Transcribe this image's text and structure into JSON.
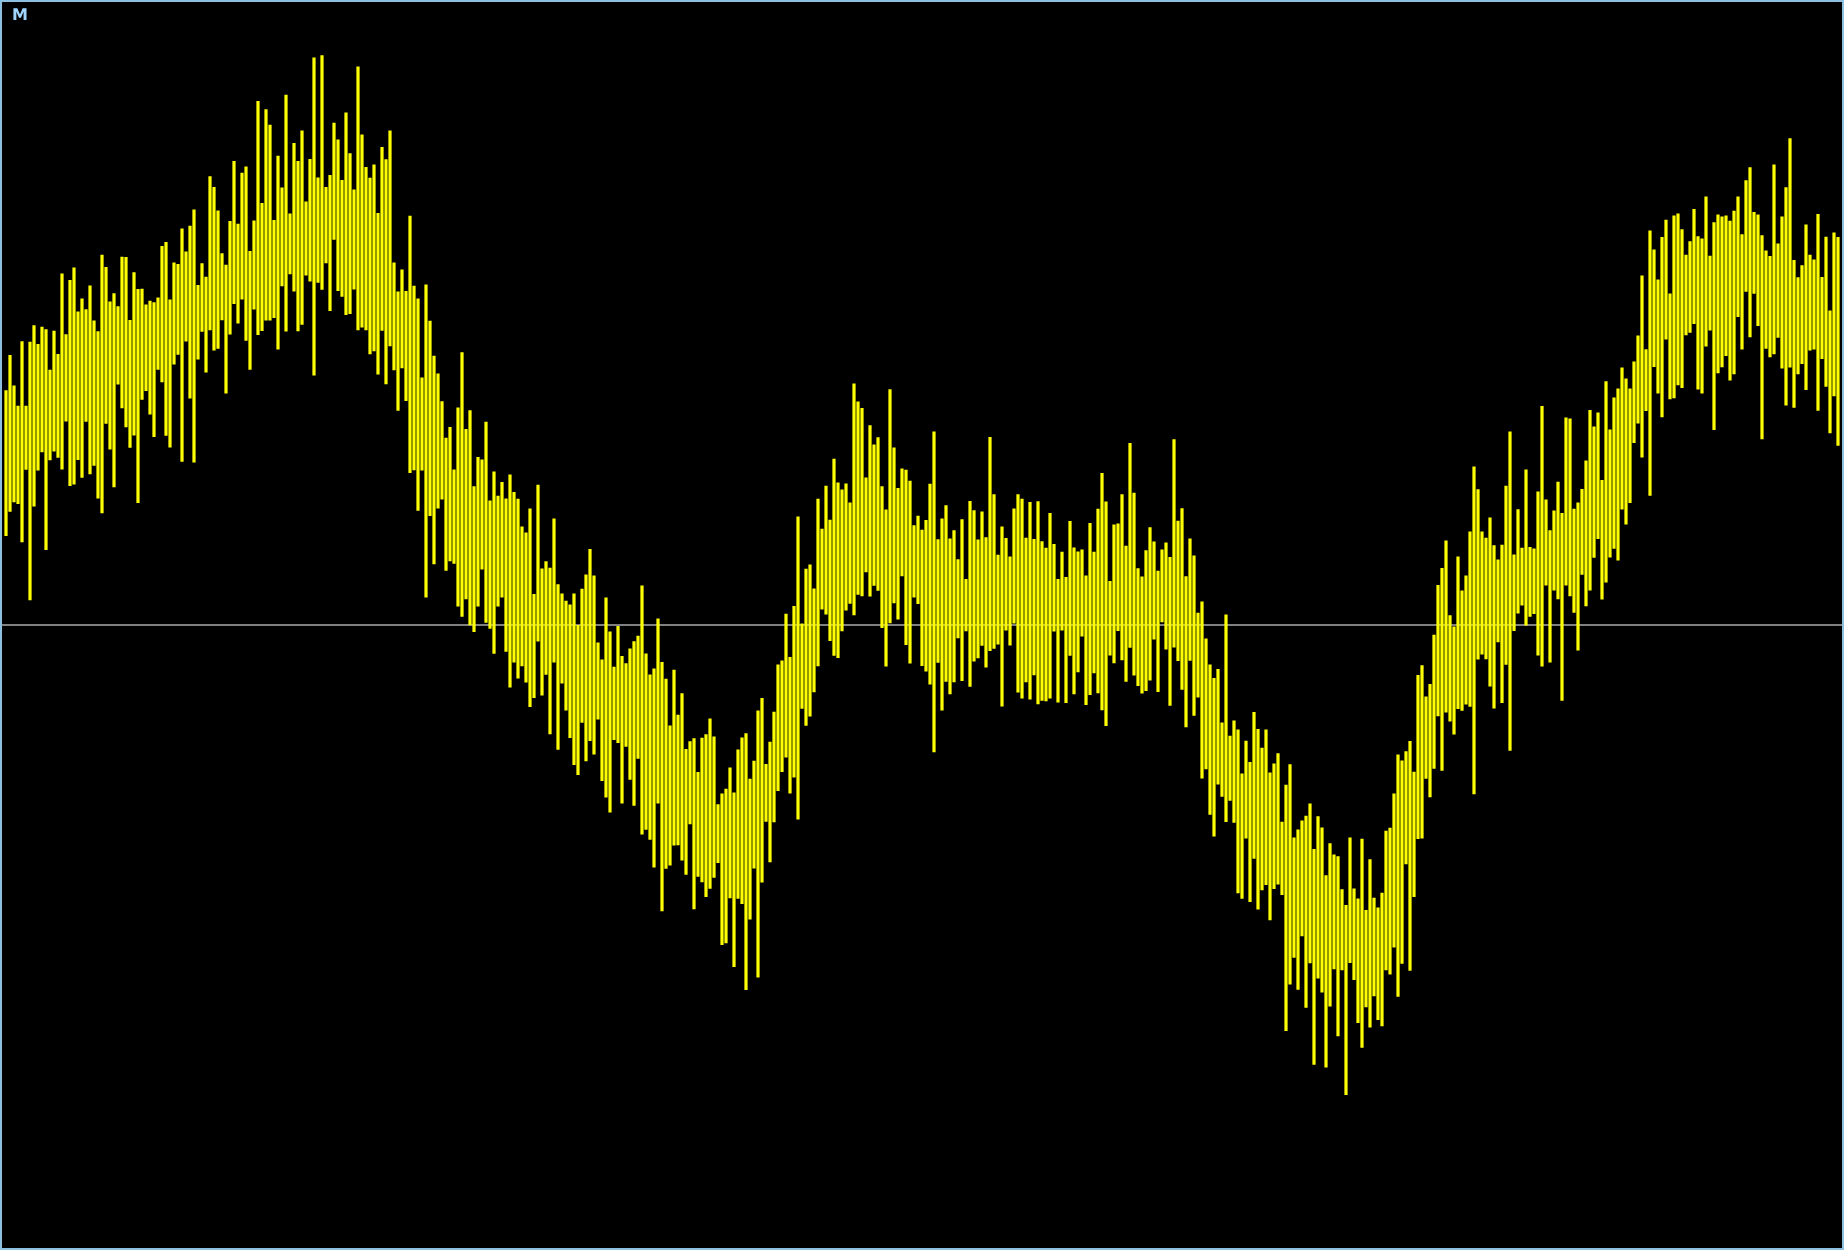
{
  "display": {
    "label": "M"
  }
}
